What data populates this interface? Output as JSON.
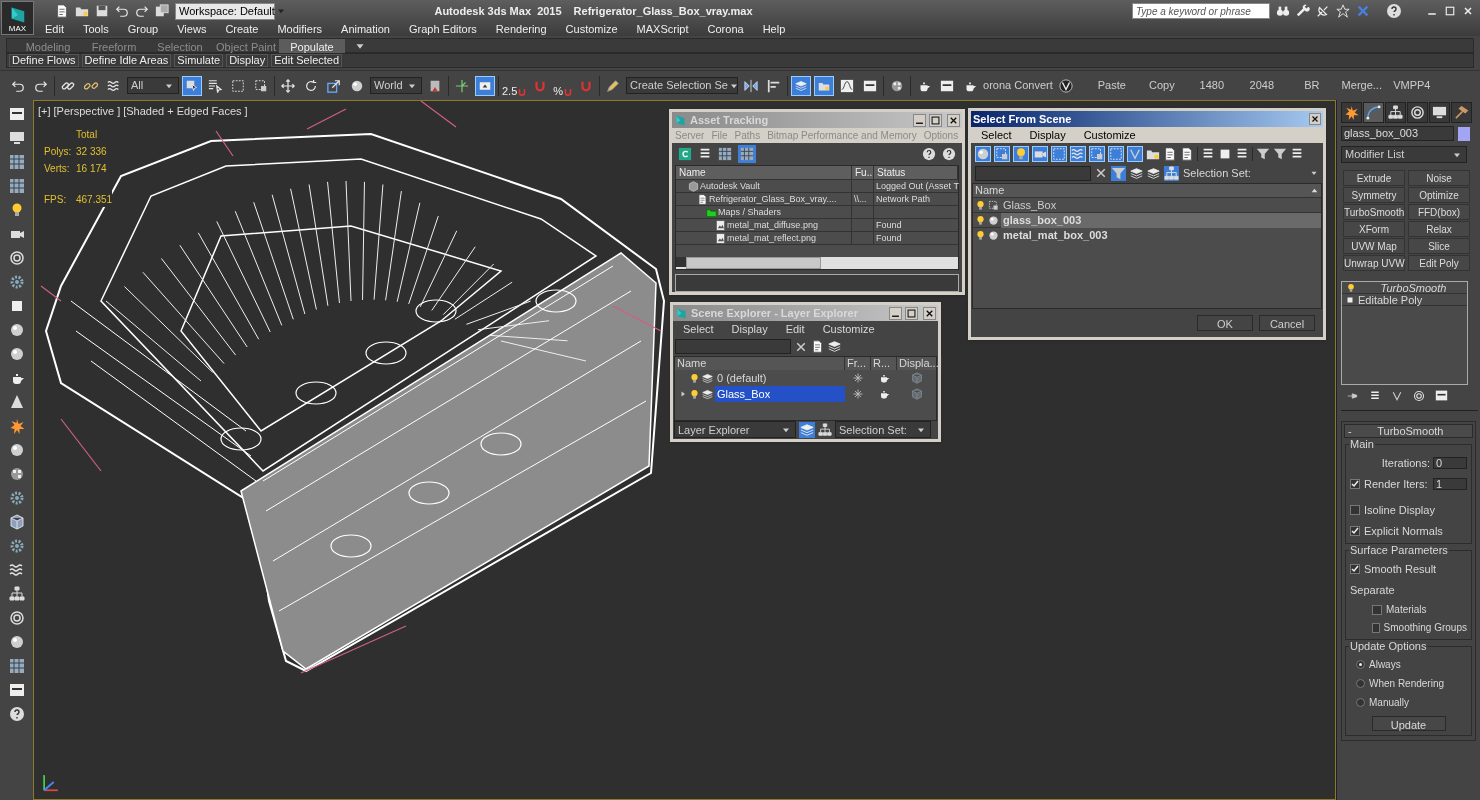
{
  "title_bar": {
    "logo": "MAX",
    "workspace": "Workspace: Default",
    "app_title": "Autodesk 3ds Max  2015",
    "file_name": "Refrigerator_Glass_Box_vray.max",
    "search": {
      "placeholder": "Type a keyword or phrase"
    }
  },
  "menu_bar": [
    "Edit",
    "Tools",
    "Group",
    "Views",
    "Create",
    "Modifiers",
    "Animation",
    "Graph Editors",
    "Rendering",
    "Customize",
    "MAXScript",
    "Corona",
    "Help"
  ],
  "ribbon": {
    "tabs": [
      {
        "label": "Modeling",
        "selected": false
      },
      {
        "label": "Freeform",
        "selected": false
      },
      {
        "label": "Selection",
        "selected": false
      },
      {
        "label": "Object Paint",
        "selected": false
      },
      {
        "label": "Populate",
        "selected": true
      }
    ],
    "buttons": [
      "Define Flows",
      "Define Idle Areas",
      "Simulate",
      "Display",
      "Edit Selected"
    ]
  },
  "main_toolbar": {
    "selection_filter": "All",
    "coordinate_system": "World",
    "snap_labels": [
      "2.5",
      "%"
    ],
    "named_selection": "Create Selection Se",
    "corona_label": "orona Convert",
    "script_buttons": [
      "Paste",
      "Copy",
      "1480",
      "2048",
      "BR",
      "Merge...",
      "VMPP4"
    ],
    "tools": [
      {
        "active": false
      },
      {
        "active": false
      },
      {
        "active": false
      },
      {
        "active": false
      },
      {
        "active": false
      },
      {
        "active": true
      },
      {
        "active": false
      },
      {
        "active": false
      },
      {
        "active": false
      },
      {
        "active": false
      },
      {
        "active": false
      },
      {
        "active": false
      },
      {
        "active": false
      },
      {
        "active": false
      },
      {
        "active": false
      },
      {
        "active": true
      },
      {
        "active": false
      },
      {
        "active": false
      },
      {
        "active": false
      },
      {
        "active": false
      },
      {
        "active": false
      },
      {
        "active": true
      },
      {
        "active": true
      },
      {
        "active": false
      },
      {
        "active": false
      },
      {
        "active": false
      },
      {
        "active": false
      },
      {
        "active": false
      },
      {
        "active": false
      },
      {
        "active": false
      }
    ]
  },
  "viewport": {
    "labels": [
      "[+]",
      "[Perspective ]",
      "[Shaded + Edged Faces ]"
    ],
    "stats": {
      "heading": "Total",
      "rows": [
        {
          "label": "Polys:",
          "value": "32 336"
        },
        {
          "label": "Verts:",
          "value": "16 174"
        }
      ],
      "fps_label": "FPS:",
      "fps_value": "467.351"
    }
  },
  "asset_tracking": {
    "title": "Asset Tracking",
    "menu": [
      "Server",
      "File",
      "Paths",
      "Bitmap Performance and Memory",
      "Options"
    ],
    "columns": [
      "Name",
      "Fu...",
      "Status"
    ],
    "rows": [
      {
        "kind": "vault",
        "name": "Autodesk Vault",
        "status": "Logged Out (Asset T",
        "children": [
          {
            "kind": "file",
            "name": "Refrigerator_Glass_Box_vray....",
            "column_2": "\\\\...",
            "status": "Network Path",
            "children": [
              {
                "kind": "folder",
                "name": "Maps / Shaders",
                "children": [
                  {
                    "kind": "image",
                    "name": "metal_mat_diffuse.png",
                    "status": "Found"
                  },
                  {
                    "kind": "image",
                    "name": "metal_mat_reflect.png",
                    "status": "Found"
                  }
                ]
              }
            ]
          }
        ]
      }
    ]
  },
  "scene_explorer": {
    "title": "Scene Explorer - Layer Explorer",
    "menu": [
      "Select",
      "Display",
      "Edit",
      "Customize"
    ],
    "columns": [
      "Name",
      "Fr...",
      "R...",
      "Displa..."
    ],
    "rows": [
      {
        "name": "0 (default)",
        "selected": false,
        "expandable": false
      },
      {
        "name": "Glass_Box",
        "selected": true,
        "expandable": true
      }
    ],
    "explorer_type": "Layer Explorer",
    "selection_set": "Selection Set:"
  },
  "select_from_scene": {
    "title": "Select From Scene",
    "menu": [
      "Select",
      "Display",
      "Customize"
    ],
    "filters": [
      {
        "on": true
      },
      {
        "on": true
      },
      {
        "on": true
      },
      {
        "on": true
      },
      {
        "on": true
      },
      {
        "on": true
      },
      {
        "on": true
      },
      {
        "on": true
      },
      {
        "on": true
      }
    ],
    "selection_set": "Selection Set:",
    "column": "Name",
    "rows": [
      {
        "kind": "group",
        "name": "Glass_Box",
        "selected": false
      },
      {
        "kind": "object",
        "name": "glass_box_003",
        "selected": true
      },
      {
        "kind": "object",
        "name": "metal_mat_box_003",
        "selected": false
      }
    ],
    "buttons": [
      "OK",
      "Cancel"
    ]
  },
  "command_panel": {
    "tabs": [
      {
        "selected": false
      },
      {
        "selected": true
      },
      {
        "selected": false
      },
      {
        "selected": false
      },
      {
        "selected": false
      },
      {
        "selected": false
      }
    ],
    "object_name": "glass_box_003",
    "modifier_list": "Modifier List",
    "modifier_buttons": [
      "Extrude",
      "Noise",
      "Symmetry",
      "Optimize",
      "TurboSmooth",
      "FFD(box)",
      "XForm",
      "Relax",
      "UVW Map",
      "Slice",
      "Unwrap UVW",
      "Edit Poly"
    ],
    "stack": [
      {
        "kind": "modifier",
        "name": "TurboSmooth"
      },
      {
        "kind": "base",
        "name": "Editable Poly"
      }
    ],
    "rollout": {
      "toggle": "-",
      "title": "TurboSmooth",
      "main": {
        "title": "Main",
        "iterations_label": "Iterations:",
        "iterations": "0",
        "render_iters": {
          "label": "Render Iters:",
          "checked": true,
          "value": "1"
        },
        "isoline_display": {
          "label": "Isoline Display",
          "checked": false
        },
        "explicit_normals": {
          "label": "Explicit Normals",
          "checked": true
        }
      },
      "surface": {
        "title": "Surface Parameters",
        "smooth_result": {
          "label": "Smooth Result",
          "checked": true
        },
        "separate_label": "Separate",
        "materials": {
          "label": "Materials",
          "checked": false
        },
        "smoothing_groups": {
          "label": "Smoothing Groups",
          "checked": false
        }
      },
      "update": {
        "title": "Update Options",
        "options": [
          {
            "label": "Always",
            "selected": true
          },
          {
            "label": "When Rendering",
            "selected": false
          },
          {
            "label": "Manually",
            "selected": false
          }
        ],
        "button": "Update"
      }
    }
  }
}
